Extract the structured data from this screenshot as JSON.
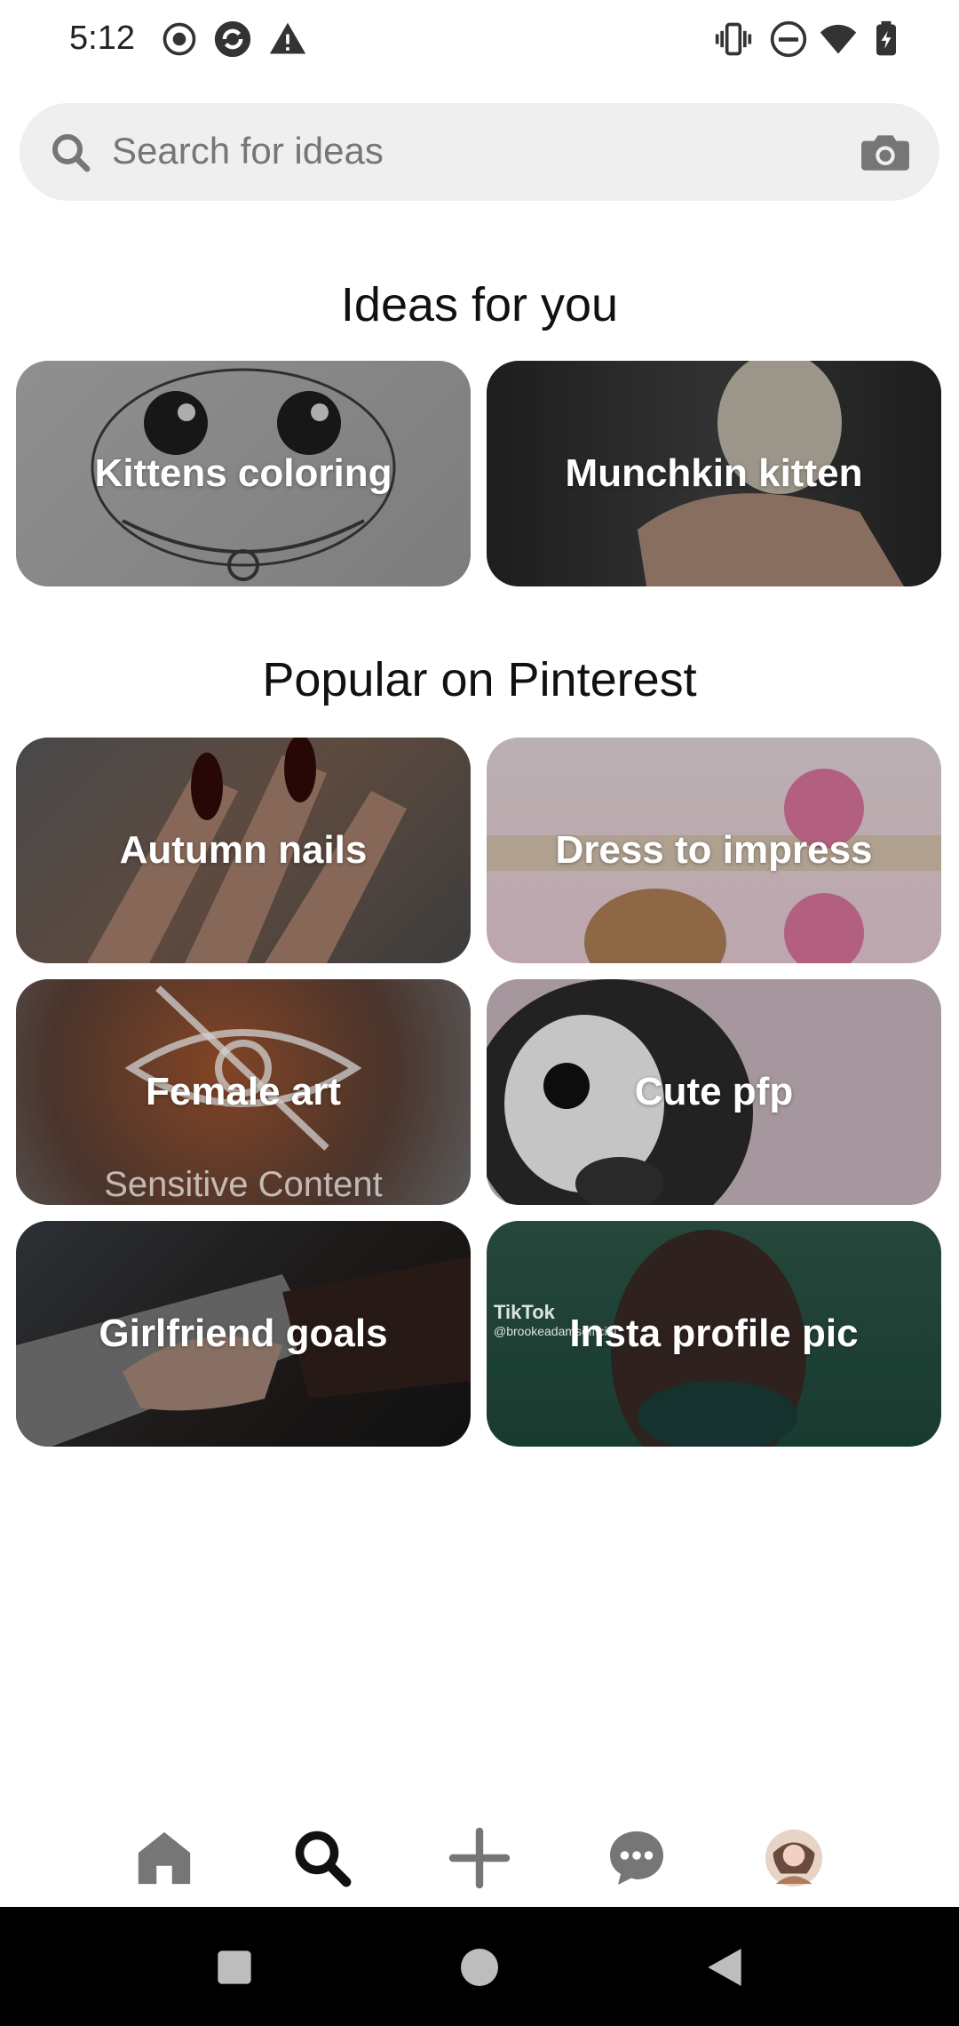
{
  "status_bar": {
    "time": "5:12",
    "left_icons": [
      "record-icon",
      "sync-icon",
      "warning-icon"
    ],
    "right_icons": [
      "vibrate-icon",
      "do-not-disturb-icon",
      "wifi-icon",
      "battery-icon"
    ]
  },
  "search": {
    "placeholder": "Search for ideas",
    "icons": [
      "search-icon",
      "camera-icon"
    ]
  },
  "ideas_for_you": {
    "title": "Ideas for you",
    "items": [
      {
        "label": "Kittens coloring"
      },
      {
        "label": "Munchkin kitten"
      }
    ]
  },
  "popular": {
    "title": "Popular on Pinterest",
    "items": [
      {
        "label": "Autumn nails"
      },
      {
        "label": "Dress to impress"
      },
      {
        "label": "Female art",
        "overlay_text": "Sensitive Content"
      },
      {
        "label": "Cute pfp"
      },
      {
        "label": "Girlfriend goals"
      },
      {
        "label": "Insta profile pic",
        "watermark": "TikTok",
        "watermark_handle": "@brookeadamsofficial"
      }
    ]
  },
  "bottom_nav": {
    "items": [
      {
        "icon": "home-icon",
        "active": false
      },
      {
        "icon": "search-icon",
        "active": true
      },
      {
        "icon": "plus-icon",
        "active": false
      },
      {
        "icon": "chat-icon",
        "active": false
      },
      {
        "icon": "profile-avatar",
        "active": false
      }
    ]
  },
  "system_nav": {
    "buttons": [
      "recents-button",
      "home-button",
      "back-button"
    ]
  },
  "colors": {
    "search_bg": "#efefef",
    "text": "#111111",
    "nav_inactive": "#767676",
    "nav_active": "#111111"
  }
}
